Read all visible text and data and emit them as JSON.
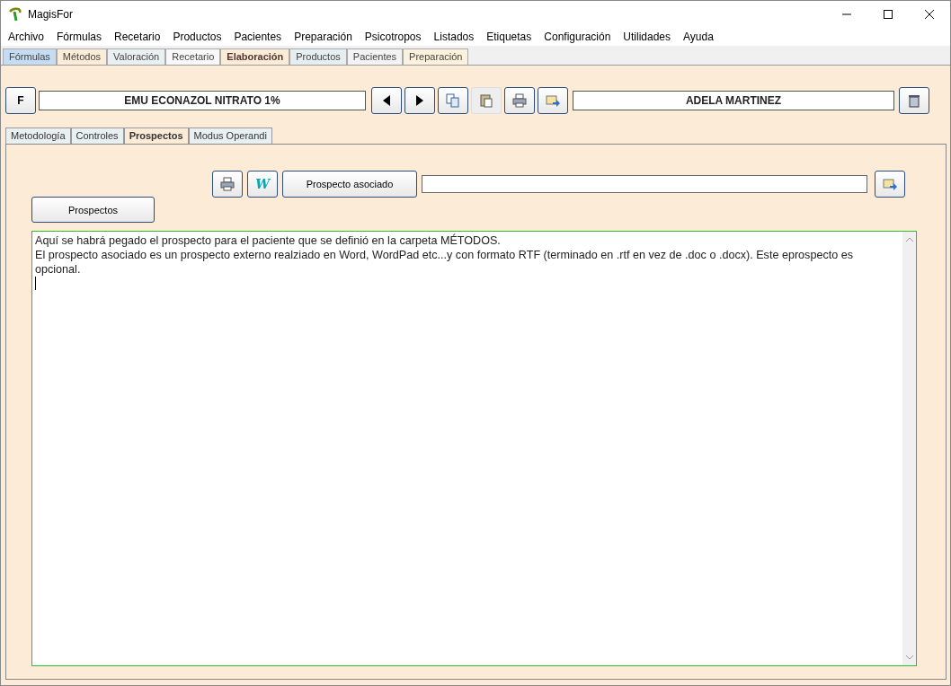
{
  "window": {
    "title": "MagisFor"
  },
  "menu": [
    "Archivo",
    "Fórmulas",
    "Recetario",
    "Productos",
    "Pacientes",
    "Preparación",
    "Psicotropos",
    "Listados",
    "Etiquetas",
    "Configuración",
    "Utilidades",
    "Ayuda"
  ],
  "main_tabs": [
    {
      "label": "Fórmulas",
      "selected": false,
      "color": "#c5dcf2"
    },
    {
      "label": "Métodos",
      "selected": false,
      "color": "#fbecd8"
    },
    {
      "label": "Valoración",
      "selected": false,
      "color": "#eaf0f2"
    },
    {
      "label": "Recetario",
      "selected": false,
      "color": "#f8f8f8"
    },
    {
      "label": "Elaboración",
      "selected": true,
      "color": "#fbecd8"
    },
    {
      "label": "Productos",
      "selected": false,
      "color": "#e5eef0"
    },
    {
      "label": "Pacientes",
      "selected": false,
      "color": "#f3f3f3"
    },
    {
      "label": "Preparación",
      "selected": false,
      "color": "#fbf1dc"
    }
  ],
  "toolbar": {
    "f_button": "F",
    "formula": "EMU ECONAZOL NITRATO 1%",
    "patient": "ADELA MARTINEZ"
  },
  "sub_tabs": [
    {
      "label": "Metodología",
      "selected": false
    },
    {
      "label": "Controles",
      "selected": false
    },
    {
      "label": "Prospectos",
      "selected": true
    },
    {
      "label": "Modus Operandi",
      "selected": false
    }
  ],
  "w_button": "W",
  "prospecto_asociado_button": "Prospecto asociado",
  "prospectos_button": "Prospectos",
  "text_lines": [
    "Aquí se habrá pegado el prospecto para el paciente que se definió en la carpeta MÉTODOS.",
    "El prospecto asociado es un prospecto externo realziado en Word, WordPad etc...y con formato RTF (terminado en .rtf en vez de .doc o .docx). Este eprospecto es opcional."
  ]
}
